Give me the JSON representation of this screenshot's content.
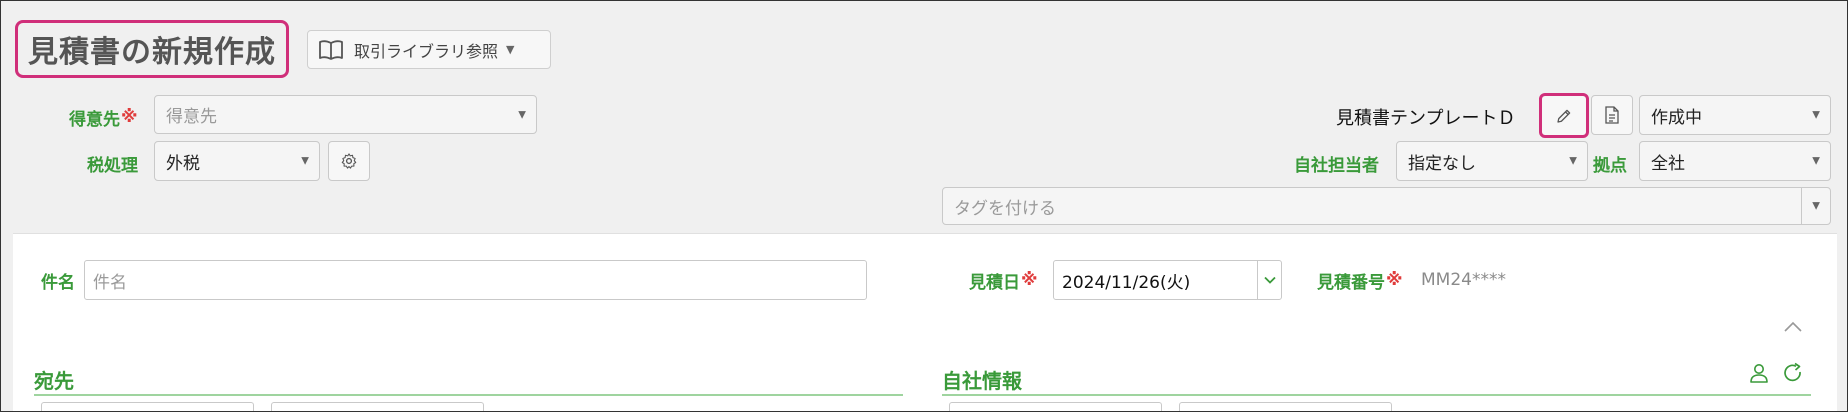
{
  "header": {
    "page_title": "見積書の新規作成",
    "library_button": "取引ライブラリ参照"
  },
  "form": {
    "customer_label": "得意先",
    "customer_required": "※",
    "customer_placeholder": "得意先",
    "tax_label": "税処理",
    "tax_value": "外税",
    "template_label": "見積書テンプレートＤ",
    "status_value": "作成中",
    "staff_label": "自社担当者",
    "staff_value": "指定なし",
    "branch_label": "拠点",
    "branch_value": "全社",
    "tag_placeholder": "タグを付ける"
  },
  "details": {
    "subject_label": "件名",
    "subject_placeholder": "件名",
    "date_label": "見積日",
    "date_required": "※",
    "date_value": "2024/11/26(火)",
    "number_label": "見積番号",
    "number_required": "※",
    "number_value": "MM24****",
    "recipient_section": "宛先",
    "company_section": "自社情報"
  },
  "colors": {
    "accent_green": "#3a9a3a",
    "highlight_pink": "#d02f7a",
    "required_red": "#e03b3b"
  },
  "icons": [
    "book-icon",
    "pencil-icon",
    "document-icon",
    "gear-icon",
    "chevron-up-icon",
    "person-icon",
    "refresh-icon"
  ]
}
